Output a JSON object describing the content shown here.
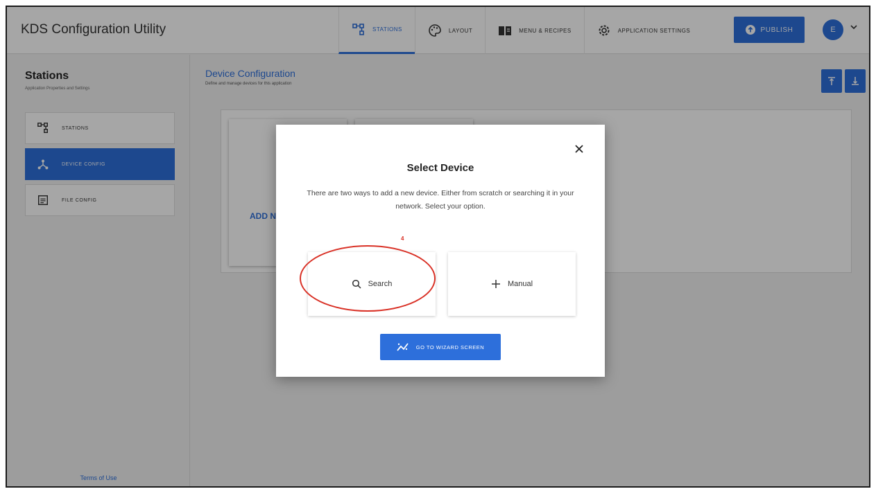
{
  "app": {
    "title": "KDS Configuration Utility"
  },
  "nav": {
    "tabs": [
      {
        "label": "STATIONS",
        "icon": "stations-icon",
        "active": true
      },
      {
        "label": "LAYOUT",
        "icon": "palette-icon",
        "active": false
      },
      {
        "label": "MENU & RECIPES",
        "icon": "book-icon",
        "active": false
      },
      {
        "label": "APPLICATION SETTINGS",
        "icon": "gear-icon",
        "active": false
      }
    ],
    "publish_label": "PUBLISH",
    "avatar_initial": "E"
  },
  "sidebar": {
    "title": "Stations",
    "subtitle": "Application Properties and Settings",
    "items": [
      {
        "label": "STATIONS",
        "icon": "stations-icon",
        "active": false
      },
      {
        "label": "DEVICE CONFIG",
        "icon": "device-tree-icon",
        "active": true
      },
      {
        "label": "FILE CONFIG",
        "icon": "file-icon",
        "active": false
      }
    ],
    "footer_link": "Terms of Use"
  },
  "main": {
    "title": "Device Configuration",
    "subtitle": "Define and manage devices for this application",
    "add_card_label": "ADD N"
  },
  "modal": {
    "title": "Select Device",
    "description": "There are two ways to add a new device. Either from scratch or searching it in your network. Select your option.",
    "step_marker": "4",
    "options": [
      {
        "label": "Search",
        "icon": "search-icon"
      },
      {
        "label": "Manual",
        "icon": "plus-icon"
      }
    ],
    "wizard_label": "GO TO WIZARD SCREEN"
  },
  "colors": {
    "accent": "#2d6fdb",
    "annotation": "#d93025",
    "overlay": "rgba(0,0,0,0.35)"
  }
}
